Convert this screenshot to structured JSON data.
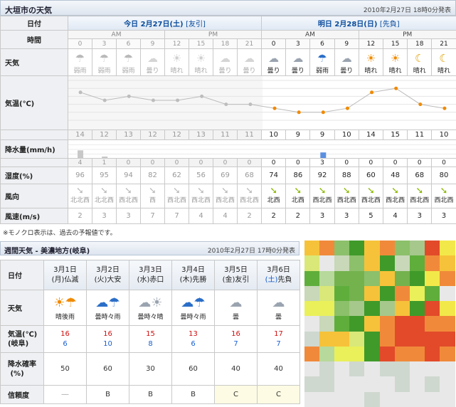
{
  "header": {
    "title": "大垣市の天気",
    "issued": "2010年2月27日 18時0分発表"
  },
  "labels": {
    "date": "日付",
    "time": "時間",
    "weather": "天気",
    "temp": "気温(℃)",
    "precip": "降水量(mm/h)",
    "humidity": "湿度(%)",
    "wind_dir": "風向",
    "wind_speed": "風速(m/s)"
  },
  "days": [
    {
      "label": "今日 2月27日(土)",
      "rokuyo": "[友引]"
    },
    {
      "label": "明日 2月28日(日)",
      "rokuyo": "[先負]"
    }
  ],
  "ampm": [
    "AM",
    "PM",
    "AM",
    "PM"
  ],
  "temp_axis": [
    "17",
    "15",
    "13",
    "11",
    "9",
    "7"
  ],
  "hours": [
    {
      "h": "0",
      "icon": "umbrella-icon",
      "wx": "弱雨",
      "temp": "14",
      "rain": "4",
      "hum": "96",
      "wdir": "北北西",
      "ws": "2",
      "past": true
    },
    {
      "h": "3",
      "icon": "umbrella-icon",
      "wx": "弱雨",
      "temp": "12",
      "rain": "1",
      "hum": "95",
      "wdir": "北北西",
      "ws": "3",
      "past": true
    },
    {
      "h": "6",
      "icon": "umbrella-icon",
      "wx": "弱雨",
      "temp": "13",
      "rain": "0",
      "hum": "94",
      "wdir": "西北西",
      "ws": "3",
      "past": true
    },
    {
      "h": "9",
      "icon": "cloud-icon",
      "wx": "曇り",
      "temp": "12",
      "rain": "0",
      "hum": "82",
      "wdir": "西",
      "ws": "7",
      "past": true
    },
    {
      "h": "12",
      "icon": "sun-icon",
      "wx": "晴れ",
      "temp": "12",
      "rain": "0",
      "hum": "62",
      "wdir": "西北西",
      "ws": "7",
      "past": true
    },
    {
      "h": "15",
      "icon": "sun-icon",
      "wx": "晴れ",
      "temp": "13",
      "rain": "0",
      "hum": "56",
      "wdir": "西北西",
      "ws": "4",
      "past": true
    },
    {
      "h": "18",
      "icon": "cloud-icon",
      "wx": "曇り",
      "temp": "11",
      "rain": "0",
      "hum": "69",
      "wdir": "西北西",
      "ws": "4",
      "past": true
    },
    {
      "h": "21",
      "icon": "cloud-icon",
      "wx": "曇り",
      "temp": "11",
      "rain": "0",
      "hum": "68",
      "wdir": "西北西",
      "ws": "2",
      "past": true
    },
    {
      "h": "0",
      "icon": "cloud-icon",
      "wx": "曇り",
      "temp": "10",
      "rain": "0",
      "hum": "74",
      "wdir": "北西",
      "ws": "2",
      "past": false
    },
    {
      "h": "3",
      "icon": "cloud-icon",
      "wx": "曇り",
      "temp": "9",
      "rain": "0",
      "hum": "86",
      "wdir": "北西",
      "ws": "2",
      "past": false
    },
    {
      "h": "6",
      "icon": "umbrella-icon",
      "wx": "弱雨",
      "temp": "9",
      "rain": "3",
      "hum": "92",
      "wdir": "西北西",
      "ws": "3",
      "past": false
    },
    {
      "h": "9",
      "icon": "cloud-icon",
      "wx": "曇り",
      "temp": "10",
      "rain": "0",
      "hum": "88",
      "wdir": "西北西",
      "ws": "3",
      "past": false
    },
    {
      "h": "12",
      "icon": "sun-icon",
      "wx": "晴れ",
      "temp": "14",
      "rain": "0",
      "hum": "60",
      "wdir": "西北西",
      "ws": "5",
      "past": false
    },
    {
      "h": "15",
      "icon": "sun-icon",
      "wx": "晴れ",
      "temp": "15",
      "rain": "0",
      "hum": "48",
      "wdir": "西北西",
      "ws": "4",
      "past": false
    },
    {
      "h": "18",
      "icon": "moon-icon",
      "wx": "晴れ",
      "temp": "11",
      "rain": "0",
      "hum": "68",
      "wdir": "西北西",
      "ws": "3",
      "past": false
    },
    {
      "h": "21",
      "icon": "moon-icon",
      "wx": "晴れ",
      "temp": "10",
      "rain": "0",
      "hum": "80",
      "wdir": "西北西",
      "ws": "3",
      "past": false
    }
  ],
  "note": "※モノクロ表示は、過去の予報値です。",
  "weekly": {
    "title": "週間天気 - 美濃地方(岐阜)",
    "issued": "2010年2月27日 17時0分発表",
    "labels": {
      "date": "日付",
      "weather": "天気",
      "temp": "気温(℃)",
      "temp_sub": "(岐阜)",
      "pop": "降水確率",
      "pop_sub": "(%)",
      "rel": "信頼度"
    },
    "days": [
      {
        "d": "3月1日",
        "w": "(月)",
        "r": "仏滅",
        "sat": false,
        "icon": "sun-rain-icon",
        "wx": "晴後雨",
        "hi": "16",
        "lo": "6",
        "pop": "50",
        "rel": "―"
      },
      {
        "d": "3月2日",
        "w": "(火)",
        "r": "大安",
        "sat": false,
        "icon": "cloud-rain-icon",
        "wx": "曇時々雨",
        "hi": "16",
        "lo": "10",
        "pop": "60",
        "rel": "B"
      },
      {
        "d": "3月3日",
        "w": "(水)",
        "r": "赤口",
        "sat": false,
        "icon": "cloud-sun-icon",
        "wx": "曇時々晴",
        "hi": "15",
        "lo": "8",
        "pop": "30",
        "rel": "B"
      },
      {
        "d": "3月4日",
        "w": "(木)",
        "r": "先勝",
        "sat": false,
        "icon": "cloud-rain-icon",
        "wx": "曇時々雨",
        "hi": "13",
        "lo": "6",
        "pop": "60",
        "rel": "B"
      },
      {
        "d": "3月5日",
        "w": "(金)",
        "r": "友引",
        "sat": false,
        "icon": "cloud-icon",
        "wx": "曇",
        "hi": "16",
        "lo": "7",
        "pop": "40",
        "rel": "C"
      },
      {
        "d": "3月6日",
        "w": "(土)",
        "r": "先負",
        "sat": true,
        "icon": "cloud-icon",
        "wx": "曇",
        "hi": "17",
        "lo": "7",
        "pop": "40",
        "rel": "C"
      }
    ]
  },
  "colors": {
    "accent_blue": "#0a4c9c",
    "temp_hi": "#d01010",
    "temp_lo": "#1a5fd0",
    "forecast_point": "#f08a00"
  }
}
